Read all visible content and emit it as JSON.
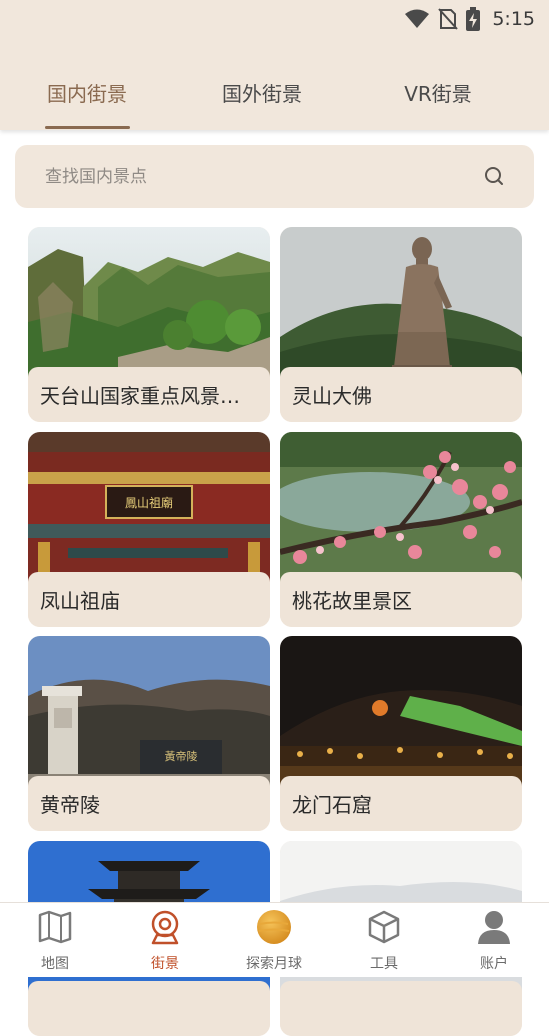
{
  "status_bar": {
    "time": "5:15",
    "icons": [
      "wifi-icon",
      "no-sim-icon",
      "battery-charging-icon"
    ]
  },
  "tabs": [
    {
      "label": "国内街景",
      "active": true
    },
    {
      "label": "国外街景",
      "active": false
    },
    {
      "label": "VR街景",
      "active": false
    }
  ],
  "search": {
    "placeholder": "查找国内景点",
    "value": "",
    "icon": "search-icon"
  },
  "scenic_spots": [
    {
      "name": "天台山国家重点风景名胜区",
      "photo": "mountain-cliffs"
    },
    {
      "name": "灵山大佛",
      "photo": "buddha-statue"
    },
    {
      "name": "凤山祖庙",
      "photo": "temple-eaves"
    },
    {
      "name": "桃花故里景区",
      "photo": "peach-blossoms"
    },
    {
      "name": "黄帝陵",
      "photo": "stone-monument"
    },
    {
      "name": "龙门石窟",
      "photo": "night-hillside"
    },
    {
      "name": "",
      "photo": "pagoda"
    },
    {
      "name": "",
      "photo": "misty-mountains"
    }
  ],
  "bottom_nav": [
    {
      "label": "地图",
      "icon": "map-icon",
      "active": false
    },
    {
      "label": "街景",
      "icon": "street-view-icon",
      "active": true
    },
    {
      "label": "探索月球",
      "icon": "moon-icon",
      "active": false
    },
    {
      "label": "工具",
      "icon": "cube-icon",
      "active": false
    },
    {
      "label": "账户",
      "icon": "user-icon",
      "active": false
    }
  ],
  "colors": {
    "header_bg": "#f1e7dc",
    "accent": "#8a6a50",
    "nav_active": "#c0502a",
    "card_caption_bg": "#efe4d8"
  }
}
